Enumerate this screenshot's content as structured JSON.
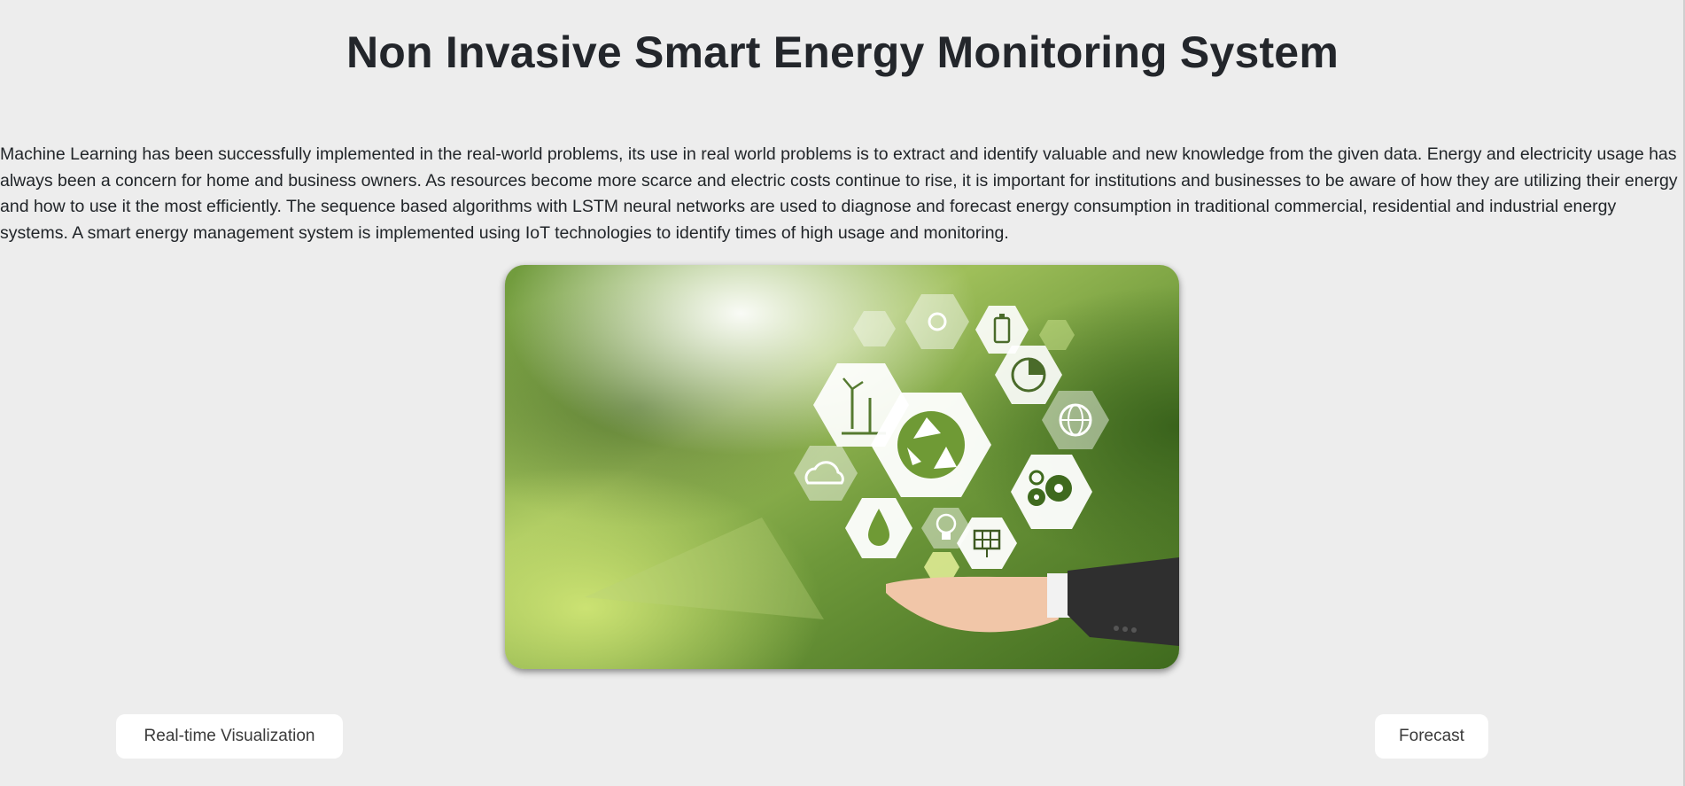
{
  "page": {
    "title": "Non Invasive Smart Energy Monitoring System",
    "description": "Machine Learning has been successfully implemented in the real-world problems, its use in real world problems is to extract and identify valuable and new knowledge from the given data. Energy and electricity usage has always been a concern for home and business owners. As resources become more scarce and electric costs continue to rise, it is important for institutions and businesses to be aware of how they are utilizing their energy and how to use it the most efficiently. The sequence based algorithms with LSTM neural networks are used to diagnose and forecast energy consumption in traditional commercial, residential and industrial energy systems. A smart energy management system is implemented using IoT technologies to identify times of high usage and monitoring."
  },
  "hero_image": {
    "icons": [
      "wind-turbine-icon",
      "recycle-icon",
      "battery-icon",
      "sun-icon",
      "pie-chart-icon",
      "globe-icon",
      "cloud-icon",
      "water-drop-icon",
      "lightbulb-icon",
      "solar-panel-icon",
      "gears-icon",
      "hand-icon"
    ]
  },
  "buttons": {
    "realtime_label": "Real-time Visualization",
    "forecast_label": "Forecast"
  },
  "colors": {
    "background": "#ededed",
    "button_bg": "#ffffff",
    "title_text": "#23262b"
  }
}
